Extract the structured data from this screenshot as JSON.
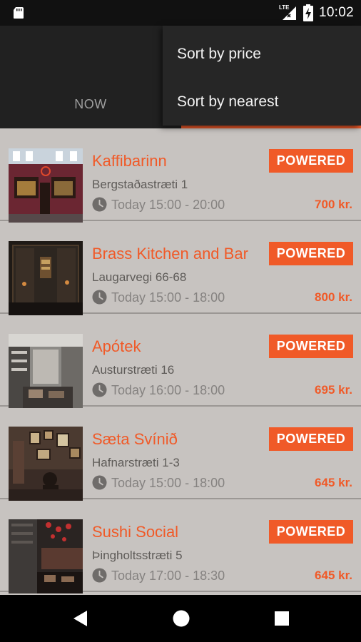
{
  "status_bar": {
    "time": "10:02",
    "network_label": "LTE",
    "icons": [
      "sd-card-icon",
      "lte-signal-icon",
      "battery-charging-icon"
    ]
  },
  "tabs": {
    "now_label": "NOW"
  },
  "sort_menu": {
    "items": [
      "Sort by price",
      "Sort by nearest"
    ]
  },
  "colors": {
    "accent": "#f05a28",
    "list_background": "#c7c3c0",
    "appbar": "#212121"
  },
  "places": [
    {
      "name": "Kaffibarinn",
      "address": "Bergstaðastræti 1",
      "hours": "Today 15:00 - 20:00",
      "price": "700 kr.",
      "badge": "POWERED"
    },
    {
      "name": "Brass Kitchen and Bar",
      "address": "Laugarvegi 66-68",
      "hours": "Today 15:00 - 18:00",
      "price": "800 kr.",
      "badge": "POWERED"
    },
    {
      "name": "Apótek",
      "address": "Austurstræti 16",
      "hours": "Today 16:00 - 18:00",
      "price": "695 kr.",
      "badge": "POWERED"
    },
    {
      "name": "Sæta Svínið",
      "address": "Hafnarstræti 1-3",
      "hours": "Today 15:00 - 18:00",
      "price": "645 kr.",
      "badge": "POWERED"
    },
    {
      "name": "Sushi Social",
      "address": "Þingholtsstræti 5",
      "hours": "Today 17:00 - 18:30",
      "price": "645 kr.",
      "badge": "POWERED"
    }
  ],
  "nav_bar": {
    "icons": [
      "back-icon",
      "home-icon",
      "recents-icon"
    ]
  }
}
